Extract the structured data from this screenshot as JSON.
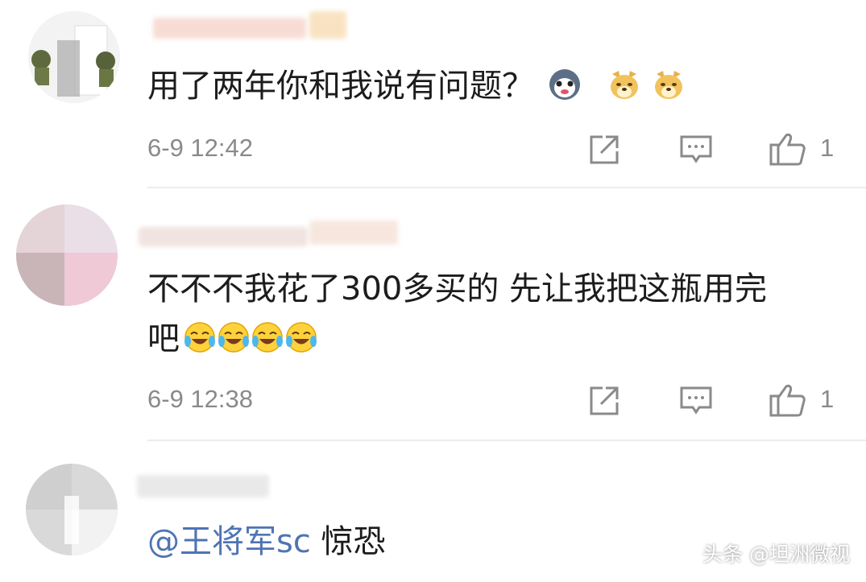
{
  "comments": [
    {
      "text": "用了两年你和我说有问题？",
      "emojis": [
        "husky-emoji",
        "doge-emoji",
        "doge-emoji"
      ],
      "time": "6-9 12:42",
      "likes": "1"
    },
    {
      "text_line1": "不不不我花了300多买的 先让我把这瓶用完",
      "text_line2": "吧",
      "emojis": [
        "laugh-cry-emoji",
        "laugh-cry-emoji",
        "laugh-cry-emoji",
        "laugh-cry-emoji"
      ],
      "time": "6-9 12:38",
      "likes": "1"
    },
    {
      "mention": "@王将军sc",
      "text": " 惊恐"
    }
  ],
  "watermark": "头条 @坦洲微视",
  "colors": {
    "mention": "#4e74b4",
    "meta": "#8a8a8a",
    "text": "#1c1c1c"
  }
}
